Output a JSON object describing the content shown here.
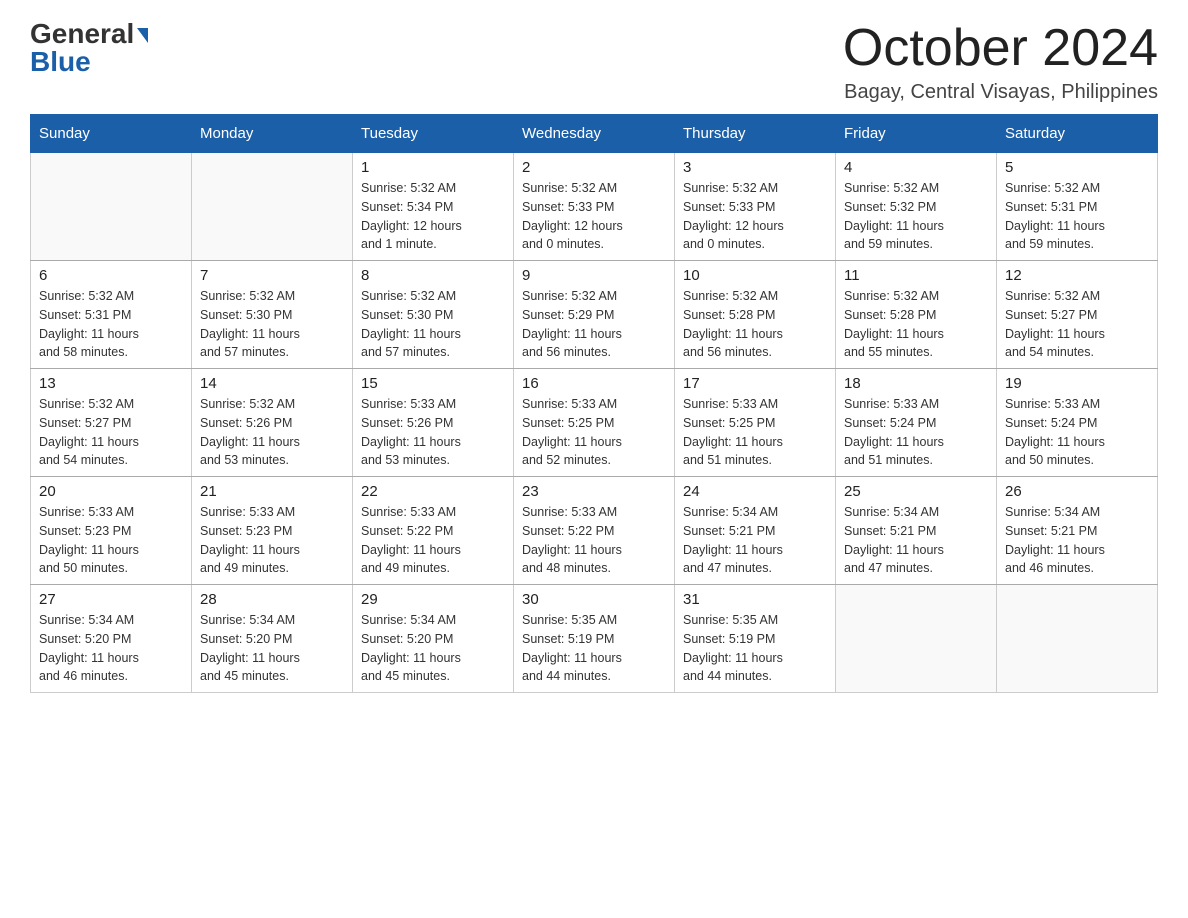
{
  "logo": {
    "general": "General",
    "triangle": "▶",
    "blue": "Blue"
  },
  "header": {
    "month": "October 2024",
    "location": "Bagay, Central Visayas, Philippines"
  },
  "weekdays": [
    "Sunday",
    "Monday",
    "Tuesday",
    "Wednesday",
    "Thursday",
    "Friday",
    "Saturday"
  ],
  "weeks": [
    [
      {
        "day": "",
        "info": ""
      },
      {
        "day": "",
        "info": ""
      },
      {
        "day": "1",
        "info": "Sunrise: 5:32 AM\nSunset: 5:34 PM\nDaylight: 12 hours\nand 1 minute."
      },
      {
        "day": "2",
        "info": "Sunrise: 5:32 AM\nSunset: 5:33 PM\nDaylight: 12 hours\nand 0 minutes."
      },
      {
        "day": "3",
        "info": "Sunrise: 5:32 AM\nSunset: 5:33 PM\nDaylight: 12 hours\nand 0 minutes."
      },
      {
        "day": "4",
        "info": "Sunrise: 5:32 AM\nSunset: 5:32 PM\nDaylight: 11 hours\nand 59 minutes."
      },
      {
        "day": "5",
        "info": "Sunrise: 5:32 AM\nSunset: 5:31 PM\nDaylight: 11 hours\nand 59 minutes."
      }
    ],
    [
      {
        "day": "6",
        "info": "Sunrise: 5:32 AM\nSunset: 5:31 PM\nDaylight: 11 hours\nand 58 minutes."
      },
      {
        "day": "7",
        "info": "Sunrise: 5:32 AM\nSunset: 5:30 PM\nDaylight: 11 hours\nand 57 minutes."
      },
      {
        "day": "8",
        "info": "Sunrise: 5:32 AM\nSunset: 5:30 PM\nDaylight: 11 hours\nand 57 minutes."
      },
      {
        "day": "9",
        "info": "Sunrise: 5:32 AM\nSunset: 5:29 PM\nDaylight: 11 hours\nand 56 minutes."
      },
      {
        "day": "10",
        "info": "Sunrise: 5:32 AM\nSunset: 5:28 PM\nDaylight: 11 hours\nand 56 minutes."
      },
      {
        "day": "11",
        "info": "Sunrise: 5:32 AM\nSunset: 5:28 PM\nDaylight: 11 hours\nand 55 minutes."
      },
      {
        "day": "12",
        "info": "Sunrise: 5:32 AM\nSunset: 5:27 PM\nDaylight: 11 hours\nand 54 minutes."
      }
    ],
    [
      {
        "day": "13",
        "info": "Sunrise: 5:32 AM\nSunset: 5:27 PM\nDaylight: 11 hours\nand 54 minutes."
      },
      {
        "day": "14",
        "info": "Sunrise: 5:32 AM\nSunset: 5:26 PM\nDaylight: 11 hours\nand 53 minutes."
      },
      {
        "day": "15",
        "info": "Sunrise: 5:33 AM\nSunset: 5:26 PM\nDaylight: 11 hours\nand 53 minutes."
      },
      {
        "day": "16",
        "info": "Sunrise: 5:33 AM\nSunset: 5:25 PM\nDaylight: 11 hours\nand 52 minutes."
      },
      {
        "day": "17",
        "info": "Sunrise: 5:33 AM\nSunset: 5:25 PM\nDaylight: 11 hours\nand 51 minutes."
      },
      {
        "day": "18",
        "info": "Sunrise: 5:33 AM\nSunset: 5:24 PM\nDaylight: 11 hours\nand 51 minutes."
      },
      {
        "day": "19",
        "info": "Sunrise: 5:33 AM\nSunset: 5:24 PM\nDaylight: 11 hours\nand 50 minutes."
      }
    ],
    [
      {
        "day": "20",
        "info": "Sunrise: 5:33 AM\nSunset: 5:23 PM\nDaylight: 11 hours\nand 50 minutes."
      },
      {
        "day": "21",
        "info": "Sunrise: 5:33 AM\nSunset: 5:23 PM\nDaylight: 11 hours\nand 49 minutes."
      },
      {
        "day": "22",
        "info": "Sunrise: 5:33 AM\nSunset: 5:22 PM\nDaylight: 11 hours\nand 49 minutes."
      },
      {
        "day": "23",
        "info": "Sunrise: 5:33 AM\nSunset: 5:22 PM\nDaylight: 11 hours\nand 48 minutes."
      },
      {
        "day": "24",
        "info": "Sunrise: 5:34 AM\nSunset: 5:21 PM\nDaylight: 11 hours\nand 47 minutes."
      },
      {
        "day": "25",
        "info": "Sunrise: 5:34 AM\nSunset: 5:21 PM\nDaylight: 11 hours\nand 47 minutes."
      },
      {
        "day": "26",
        "info": "Sunrise: 5:34 AM\nSunset: 5:21 PM\nDaylight: 11 hours\nand 46 minutes."
      }
    ],
    [
      {
        "day": "27",
        "info": "Sunrise: 5:34 AM\nSunset: 5:20 PM\nDaylight: 11 hours\nand 46 minutes."
      },
      {
        "day": "28",
        "info": "Sunrise: 5:34 AM\nSunset: 5:20 PM\nDaylight: 11 hours\nand 45 minutes."
      },
      {
        "day": "29",
        "info": "Sunrise: 5:34 AM\nSunset: 5:20 PM\nDaylight: 11 hours\nand 45 minutes."
      },
      {
        "day": "30",
        "info": "Sunrise: 5:35 AM\nSunset: 5:19 PM\nDaylight: 11 hours\nand 44 minutes."
      },
      {
        "day": "31",
        "info": "Sunrise: 5:35 AM\nSunset: 5:19 PM\nDaylight: 11 hours\nand 44 minutes."
      },
      {
        "day": "",
        "info": ""
      },
      {
        "day": "",
        "info": ""
      }
    ]
  ]
}
